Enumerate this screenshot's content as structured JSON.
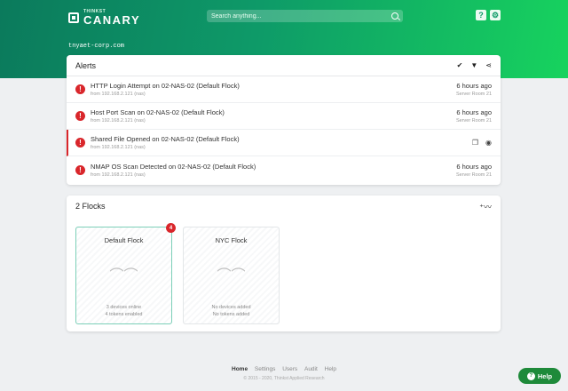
{
  "header": {
    "logo_small": "THINKST",
    "logo_big": "CANARY",
    "search_placeholder": "Search anything...",
    "help_icon": "?",
    "settings_icon": "⚙"
  },
  "tenant": "tnyaet-corp.com",
  "alerts": {
    "title": "Alerts",
    "items": [
      {
        "title": "HTTP Login Attempt on 02-NAS-02 (Default Flock)",
        "sub": "from 192.168.2.121 (nas)",
        "time": "6 hours ago",
        "device": "Server Room 21"
      },
      {
        "title": "Host Port Scan on 02-NAS-02 (Default Flock)",
        "sub": "from 192.168.2.121 (nas)",
        "time": "6 hours ago",
        "device": "Server Room 21"
      },
      {
        "title": "Shared File Opened on 02-NAS-02 (Default Flock)",
        "sub": "from 192.168.2.121 (nas)",
        "time": "",
        "device": ""
      },
      {
        "title": "NMAP OS Scan Detected on 02-NAS-02 (Default Flock)",
        "sub": "from 192.168.2.121 (nas)",
        "time": "6 hours ago",
        "device": "Server Room 21"
      }
    ]
  },
  "flocks": {
    "title": "2 Flocks",
    "items": [
      {
        "name": "Default Flock",
        "line1": "3 devices online",
        "line2": "4 tokens enabled",
        "badge": "4"
      },
      {
        "name": "NYC Flock",
        "line1": "No devices added",
        "line2": "No tokens added"
      }
    ]
  },
  "footer": {
    "nav": [
      "Home",
      "Settings",
      "Users",
      "Audit",
      "Help"
    ],
    "copyright": "© 2015 - 2020, Thinkst Applied Research"
  },
  "help_button": "Help",
  "colors": {
    "accent": "#0e9a68",
    "alert": "#d9262b",
    "help": "#1e8a3a"
  }
}
